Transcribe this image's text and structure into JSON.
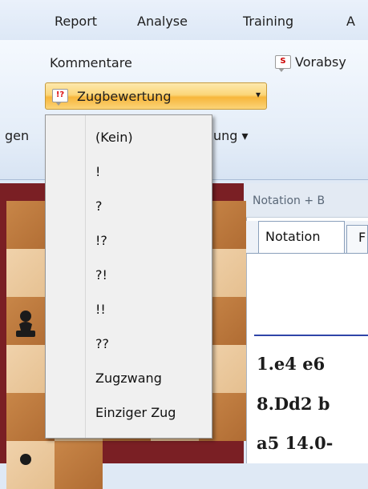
{
  "menubar": {
    "items": [
      "Report",
      "Analyse",
      "Training",
      "A"
    ]
  },
  "ribbon": {
    "left_cut_label": "gen",
    "kommentare": "Kommentare",
    "vorabsy": "Vorabsy",
    "zugbewertung": "Zugbewertung",
    "dropdown_arrow": "▾",
    "partial_label": "ung ▾"
  },
  "dropdown": {
    "items": [
      "(Kein)",
      "!",
      "?",
      "!?",
      "?!",
      "!!",
      "??",
      "Zugzwang",
      "Einziger Zug"
    ]
  },
  "notation": {
    "panel_title": "Notation + B",
    "tab_label": "Notation",
    "tab_next": "F",
    "lines": [
      "1.e4  e6",
      "8.Dd2  b",
      "a5  14.0-"
    ]
  },
  "icons": {
    "zug_icon": "!?",
    "vorabsy_icon": "S"
  },
  "colors": {
    "highlight": "#f7b63b",
    "ribbon_bg": "#e4edf8",
    "board_frame": "#7a1f24"
  }
}
